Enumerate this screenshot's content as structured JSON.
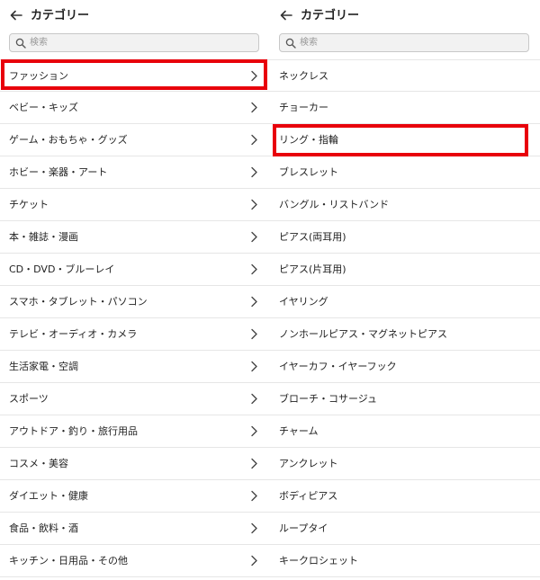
{
  "left": {
    "title": "カテゴリー",
    "search_placeholder": "検索",
    "items": [
      "ファッション",
      "ベビー・キッズ",
      "ゲーム・おもちゃ・グッズ",
      "ホビー・楽器・アート",
      "チケット",
      "本・雑誌・漫画",
      "CD・DVD・ブルーレイ",
      "スマホ・タブレット・パソコン",
      "テレビ・オーディオ・カメラ",
      "生活家電・空調",
      "スポーツ",
      "アウトドア・釣り・旅行用品",
      "コスメ・美容",
      "ダイエット・健康",
      "食品・飲料・酒",
      "キッチン・日用品・その他"
    ]
  },
  "right": {
    "title": "カテゴリー",
    "search_placeholder": "検索",
    "items": [
      "ネックレス",
      "チョーカー",
      "リング・指輪",
      "ブレスレット",
      "バングル・リストバンド",
      "ピアス(両耳用)",
      "ピアス(片耳用)",
      "イヤリング",
      "ノンホールピアス・マグネットピアス",
      "イヤーカフ・イヤーフック",
      "ブローチ・コサージュ",
      "チャーム",
      "アンクレット",
      "ボディピアス",
      "ループタイ",
      "キークロシェット"
    ]
  },
  "icons": {
    "back": "arrow-left-icon",
    "search": "search-icon",
    "chevron": "chevron-right-icon"
  },
  "colors": {
    "highlight": "#e8000b",
    "divider": "#e6e6e6",
    "search_bg": "#f2f2f2"
  }
}
